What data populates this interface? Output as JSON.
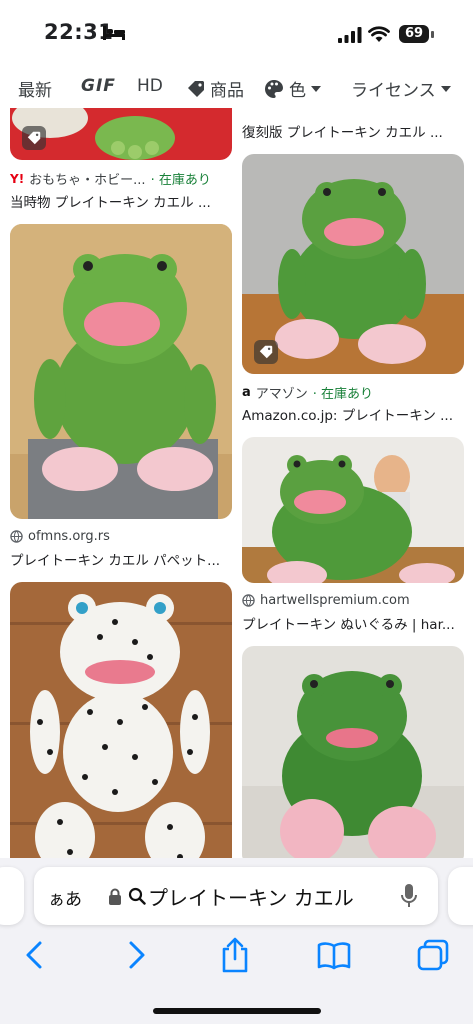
{
  "status_bar": {
    "time": "22:31",
    "battery": "69"
  },
  "filters": [
    {
      "label": "最新",
      "icon": ""
    },
    {
      "label": "GIF",
      "icon": ""
    },
    {
      "label": "HD",
      "icon": ""
    },
    {
      "label": "商品",
      "icon": "tag-icon"
    },
    {
      "label": "色",
      "icon": "palette-icon"
    },
    {
      "label": "ライセンス",
      "icon": ""
    }
  ],
  "results": {
    "left": [
      {
        "source": "おもちゃ・ホビー...",
        "stock": "· 在庫あり",
        "title": "当時物 プレイトーキン カエル ..."
      },
      {
        "source": "ofmns.org.rs",
        "stock": "",
        "title": "プレイトーキン カエル パペット..."
      }
    ],
    "right": [
      {
        "source": "",
        "stock": "",
        "title": "復刻版 プレイトーキン カエル ..."
      },
      {
        "source": "アマゾン",
        "stock": "· 在庫あり",
        "title": "Amazon.co.jp: プレイトーキン ..."
      },
      {
        "source": "hartwellspremium.com",
        "stock": "",
        "title": "プレイトーキン ぬいぐるみ | har..."
      }
    ]
  },
  "address_bar": {
    "aa_label": "ぁあ",
    "query": "プレイトーキン カエル"
  },
  "toolbar": {
    "icons": [
      "back-icon",
      "forward-icon",
      "share-icon",
      "bookmarks-icon",
      "tabs-icon"
    ]
  },
  "colors": {
    "accent": "#0a84ff",
    "stock_green": "#188038",
    "frog_green": "#5aa040",
    "mouth_pink": "#f08a9c"
  }
}
